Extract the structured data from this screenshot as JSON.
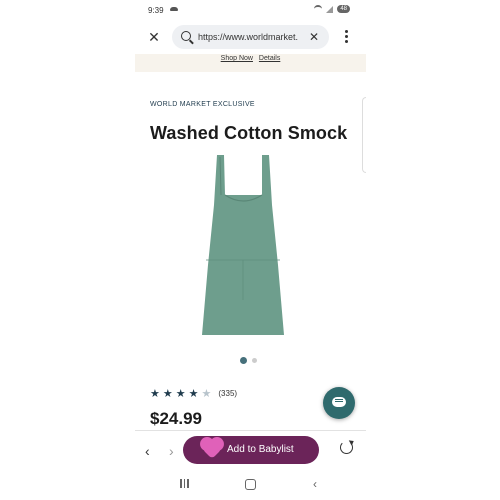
{
  "status_bar": {
    "time": "9:39",
    "battery": "48"
  },
  "browser": {
    "url": "https://www.worldmarket.com",
    "close_label": "✕",
    "clear_label": "✕"
  },
  "promo": {
    "shop_now": "Shop Now",
    "details": "Details"
  },
  "product": {
    "eyebrow": "WORLD MARKET EXCLUSIVE",
    "title": "Washed Cotton Smock",
    "image_color": "#6e9e8d",
    "gallery_active_index": 0,
    "gallery_count": 2,
    "rating_stars": 4.5,
    "rating_count": "(335)",
    "price": "$24.99"
  },
  "toolbar": {
    "back": "‹",
    "forward": "›",
    "babylist_label": "Add to Babylist",
    "babylist_color": "#6b2459"
  },
  "navbar": {
    "back": "‹"
  }
}
